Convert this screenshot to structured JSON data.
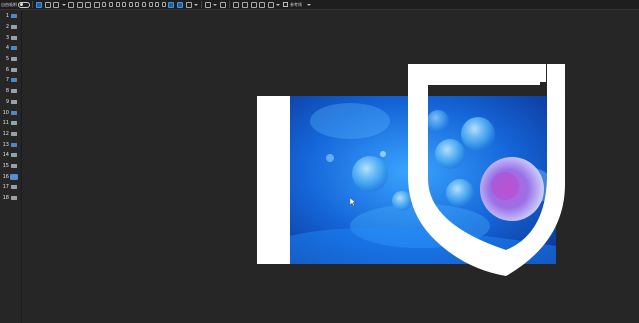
{
  "toolbar": {
    "snap_label": "自由吸附",
    "snap_enabled": true,
    "preview_label": "参考线",
    "icons": [
      "frame-icon",
      "select-icon",
      "crop-icon",
      "copy-icon",
      "paste-icon",
      "layer-icon",
      "group-icon",
      "align-left-icon",
      "align-center-icon",
      "align-right-icon",
      "align-top-icon",
      "align-middle-icon",
      "align-bottom-icon",
      "distribute-h-icon",
      "distribute-v-icon",
      "flip-h-icon",
      "flip-v-icon",
      "rotate-icon",
      "bring-front-icon",
      "send-back-icon",
      "lock-icon",
      "mask-icon",
      "text-icon",
      "shape-icon",
      "effects-icon",
      "link-icon",
      "chart-icon",
      "preview-icon"
    ]
  },
  "slides": [
    {
      "num": "1"
    },
    {
      "num": "2"
    },
    {
      "num": "3"
    },
    {
      "num": "4"
    },
    {
      "num": "5"
    },
    {
      "num": "6"
    },
    {
      "num": "7"
    },
    {
      "num": "8"
    },
    {
      "num": "9"
    },
    {
      "num": "10"
    },
    {
      "num": "11"
    },
    {
      "num": "12"
    },
    {
      "num": "13"
    },
    {
      "num": "14"
    },
    {
      "num": "15"
    },
    {
      "num": "16"
    },
    {
      "num": "17"
    },
    {
      "num": "18"
    }
  ],
  "selected_slide": "16",
  "colors": {
    "background": "#262626",
    "toolbar": "#1e1e1e",
    "accent": "#4a90e2",
    "stage": "#ffffff"
  }
}
